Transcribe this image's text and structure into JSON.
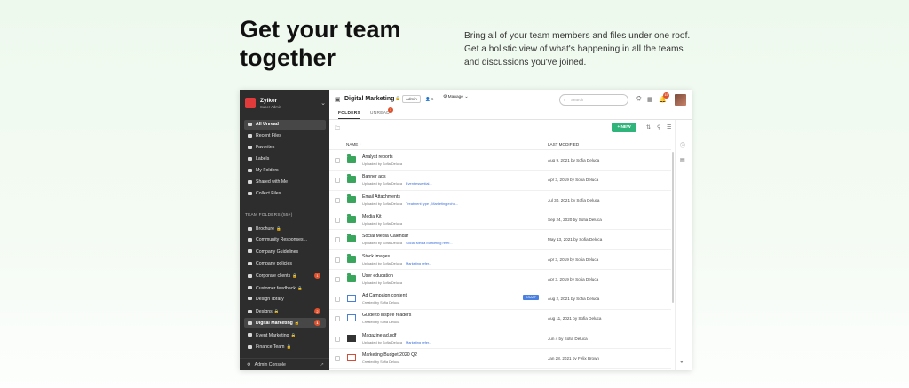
{
  "hero": {
    "title": "Get your team together",
    "description": "Bring all of your team members and files under one roof. Get a holistic view of what's happening in all the teams and discussions you've joined."
  },
  "sidebar": {
    "org_name": "Zylker",
    "org_role": "Super Admin",
    "nav": [
      {
        "label": "All Unread",
        "icon": "inbox-icon",
        "active": true
      },
      {
        "label": "Recent Files",
        "icon": "clock-icon"
      },
      {
        "label": "Favorites",
        "icon": "star-icon"
      },
      {
        "label": "Labels",
        "icon": "tag-icon"
      },
      {
        "label": "My Folders",
        "icon": "folder-icon"
      },
      {
        "label": "Shared with Me",
        "icon": "shared-icon"
      },
      {
        "label": "Collect Files",
        "icon": "collect-icon"
      }
    ],
    "team_section": "TEAM FOLDERS (55+)",
    "team_folders": [
      {
        "label": "Brochure",
        "lock": true
      },
      {
        "label": "Community Responses...",
        "lock": false
      },
      {
        "label": "Company Guidelines",
        "lock": false
      },
      {
        "label": "Company policies",
        "lock": false
      },
      {
        "label": "Corporate clients",
        "lock": true,
        "badge": "1"
      },
      {
        "label": "Customer feedback",
        "lock": true
      },
      {
        "label": "Design library",
        "lock": false
      },
      {
        "label": "Designs",
        "lock": true,
        "badge": "2"
      },
      {
        "label": "Digital Marketing",
        "lock": true,
        "badge": "1",
        "active": true
      },
      {
        "label": "Event Marketing",
        "lock": true
      },
      {
        "label": "Finance Team",
        "lock": true
      }
    ],
    "footer": "Admin Console"
  },
  "header": {
    "title": "Digital Marketing",
    "role": "Admin",
    "members": "6",
    "manage": "Manage",
    "search_placeholder": "Search",
    "notif_count": "15"
  },
  "tabs": [
    {
      "label": "FOLDERS",
      "active": true
    },
    {
      "label": "UNREAD",
      "badge": "1"
    }
  ],
  "toolbar": {
    "new_label": "+ NEW"
  },
  "columns": {
    "name": "NAME",
    "modified": "LAST MODIFIED"
  },
  "files": [
    {
      "name": "Analyst reports",
      "sub": "Uploaded by Sofia Deluca",
      "tag": "",
      "type": "folder",
      "modified": "Aug 9, 2021 by Sofia Deluca"
    },
    {
      "name": "Banner ads",
      "sub": "Uploaded by Sofia Deluca",
      "tag": "Event essential...",
      "type": "folder",
      "modified": "Apr 3, 2019 by Sofia Deluca"
    },
    {
      "name": "Email Attachments",
      "sub": "Uploaded by Sofia Deluca",
      "tag": "Treatment type , Marketing echo...",
      "type": "folder",
      "modified": "Jul 30, 2021 by Sofia Deluca"
    },
    {
      "name": "Media Kit",
      "sub": "Uploaded by Sofia Deluca",
      "tag": "",
      "type": "folder",
      "modified": "Sep 24, 2020 by Sofia Deluca"
    },
    {
      "name": "Social Media Calendar",
      "sub": "Uploaded by Sofia Deluca",
      "tag": "Social Media   Marketing refer...",
      "type": "folder",
      "modified": "May 13, 2021 by Sofia Deluca"
    },
    {
      "name": "Stock images",
      "sub": "Uploaded by Sofia Deluca",
      "tag": "Marketing refer...",
      "type": "folder",
      "modified": "Apr 3, 2019 by Sofia Deluca"
    },
    {
      "name": "User education",
      "sub": "Uploaded by Sofia Deluca",
      "tag": "",
      "type": "folder",
      "modified": "Apr 3, 2019 by Sofia Deluca"
    },
    {
      "name": "Ad Campaign content",
      "sub": "Created by Sofia Deluca",
      "tag": "",
      "type": "doc",
      "draft": "DRAFT",
      "modified": "Aug 2, 2021 by Sofia Deluca"
    },
    {
      "name": "Guide to inspire readers",
      "sub": "Created by Sofia Deluca",
      "tag": "",
      "type": "doc",
      "modified": "Aug 11, 2021 by Sofia Deluca"
    },
    {
      "name": "Magazine ad.pdf",
      "sub": "Uploaded by Sofia Deluca",
      "tag": "Marketing refer...",
      "type": "img",
      "modified": "Jun 4 by Sofia Deluca"
    },
    {
      "name": "Marketing Budget 2020 Q2",
      "sub": "Created by Sofia Deluca",
      "tag": "",
      "type": "pdf",
      "modified": "Jan 28, 2021 by Felix Brown"
    }
  ],
  "colors": {
    "accent": "#2fb57b",
    "sidebar": "#2d2d2d",
    "badge": "#e0522d",
    "folder": "#3aa55d"
  }
}
